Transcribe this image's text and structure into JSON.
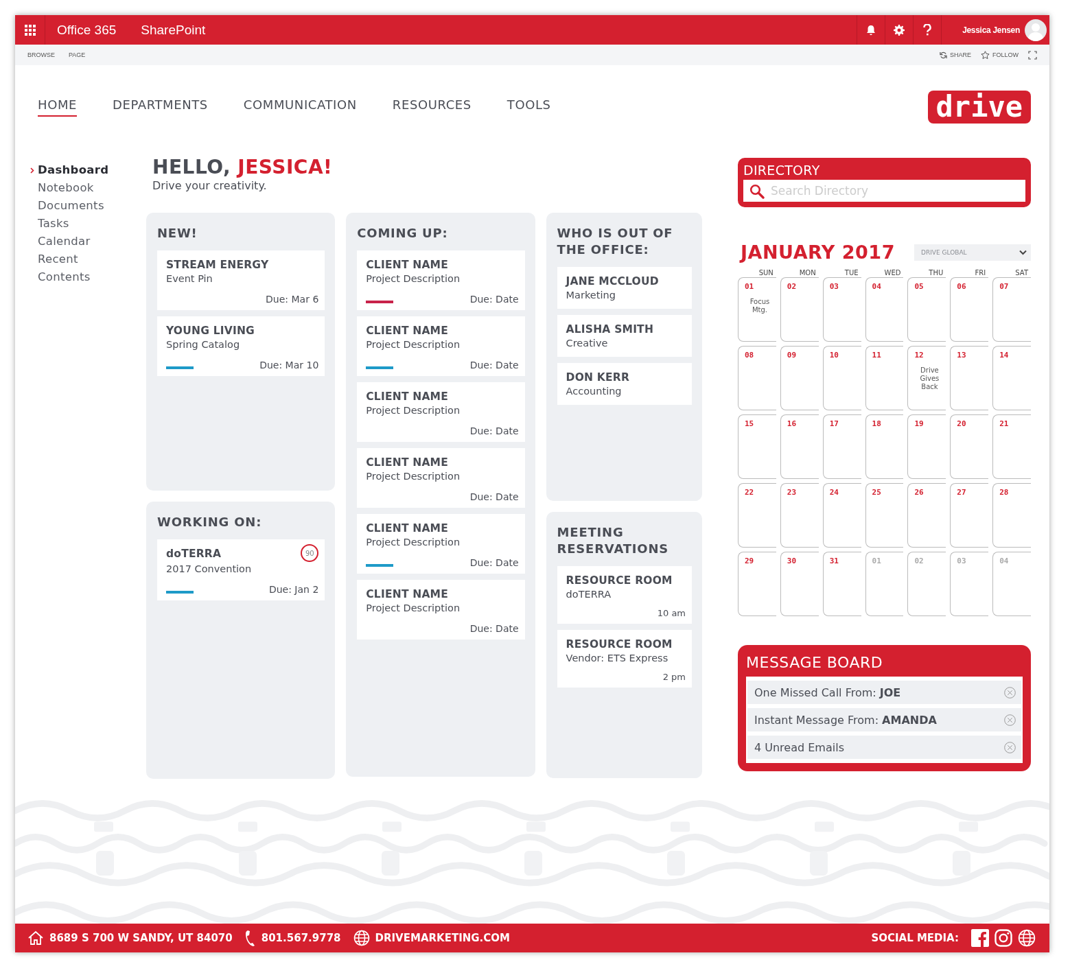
{
  "top_bar": {
    "brand": "Office 365",
    "site": "SharePoint",
    "user": "Jessica Jensen"
  },
  "ribbon_tabs": [
    "BROWSE",
    "PAGE"
  ],
  "ribbon_actions": [
    {
      "kind": "share",
      "label": "SHARE"
    },
    {
      "kind": "follow",
      "label": "FOLLOW"
    }
  ],
  "nav": [
    {
      "label": "HOME",
      "selected": true
    },
    {
      "label": "DEPARTMENTS",
      "selected": false
    },
    {
      "label": "COMMUNICATION",
      "selected": false
    },
    {
      "label": "RESOURCES",
      "selected": false
    },
    {
      "label": "TOOLS",
      "selected": false
    }
  ],
  "logo": "drive",
  "sidebar": [
    {
      "label": "Dashboard",
      "selected": true
    },
    {
      "label": "Notebook",
      "selected": false
    },
    {
      "label": "Documents",
      "selected": false
    },
    {
      "label": "Tasks",
      "selected": false
    },
    {
      "label": "Calendar",
      "selected": false
    },
    {
      "label": "Recent",
      "selected": false
    },
    {
      "label": "Contents",
      "selected": false
    }
  ],
  "greeting": {
    "hello": "HELLO,",
    "name": "JESSICA!",
    "tagline": "Drive your creativity."
  },
  "new": {
    "title": "NEW!",
    "items": [
      {
        "client": "STREAM ENERGY",
        "project": "Event Pin",
        "due": "Due: Mar 6"
      },
      {
        "client": "YOUNG LIVING",
        "project": "Spring Catalog",
        "due": "Due: Mar 10",
        "color": "#1e9ac8"
      }
    ]
  },
  "working_on": {
    "title": "WORKING ON:",
    "items": [
      {
        "client": "doTERRA",
        "project": "2017 Convention",
        "due": "Due: Jan 2",
        "color": "#1e9ac8",
        "badge": "90"
      }
    ]
  },
  "coming_up": {
    "title": "COMING UP:",
    "items": [
      {
        "client": "CLIENT NAME",
        "project": "Project Description",
        "due": "Due: Date",
        "color": "#c8234a"
      },
      {
        "client": "CLIENT NAME",
        "project": "Project Description",
        "due": "Due: Date",
        "color": "#1e9ac8"
      },
      {
        "client": "CLIENT NAME",
        "project": "Project Description",
        "due": "Due: Date"
      },
      {
        "client": "CLIENT NAME",
        "project": "Project Description",
        "due": "Due: Date"
      },
      {
        "client": "CLIENT NAME",
        "project": "Project Description",
        "due": "Due: Date",
        "color": "#1e9ac8"
      },
      {
        "client": "CLIENT NAME",
        "project": "Project Description",
        "due": "Due: Date"
      }
    ]
  },
  "out_of_office": {
    "title": "WHO IS OUT OF THE OFFICE:",
    "people": [
      {
        "name": "JANE MCCLOUD",
        "department": "Marketing"
      },
      {
        "name": "ALISHA SMITH",
        "department": "Creative"
      },
      {
        "name": "DON KERR",
        "department": "Accounting"
      }
    ]
  },
  "meetings": {
    "title": "MEETING RESERVATIONS",
    "items": [
      {
        "room": "RESOURCE ROOM",
        "detail": "doTERRA",
        "time": "10 am"
      },
      {
        "room": "RESOURCE ROOM",
        "detail": "Vendor: ETS Express",
        "time": "2 pm"
      }
    ]
  },
  "directory": {
    "title": "DIRECTORY",
    "placeholder": "Search Directory"
  },
  "calendar": {
    "title": "JANUARY 2017",
    "filter": "DRIVE GLOBAL",
    "weekdays": [
      "SUN",
      "MON",
      "TUE",
      "WED",
      "THU",
      "FRI",
      "SAT"
    ],
    "days": [
      {
        "day": "01",
        "in_month": true,
        "event": "Focus Mtg."
      },
      {
        "day": "02",
        "in_month": true
      },
      {
        "day": "03",
        "in_month": true
      },
      {
        "day": "04",
        "in_month": true
      },
      {
        "day": "05",
        "in_month": true
      },
      {
        "day": "06",
        "in_month": true
      },
      {
        "day": "07",
        "in_month": true
      },
      {
        "day": "08",
        "in_month": true
      },
      {
        "day": "09",
        "in_month": true
      },
      {
        "day": "10",
        "in_month": true
      },
      {
        "day": "11",
        "in_month": true
      },
      {
        "day": "12",
        "in_month": true,
        "event": "Drive Gives Back"
      },
      {
        "day": "13",
        "in_month": true
      },
      {
        "day": "14",
        "in_month": true
      },
      {
        "day": "15",
        "in_month": true
      },
      {
        "day": "16",
        "in_month": true
      },
      {
        "day": "17",
        "in_month": true
      },
      {
        "day": "18",
        "in_month": true
      },
      {
        "day": "19",
        "in_month": true
      },
      {
        "day": "20",
        "in_month": true
      },
      {
        "day": "21",
        "in_month": true
      },
      {
        "day": "22",
        "in_month": true
      },
      {
        "day": "23",
        "in_month": true
      },
      {
        "day": "24",
        "in_month": true
      },
      {
        "day": "25",
        "in_month": true
      },
      {
        "day": "26",
        "in_month": true
      },
      {
        "day": "27",
        "in_month": true
      },
      {
        "day": "28",
        "in_month": true
      },
      {
        "day": "29",
        "in_month": true
      },
      {
        "day": "30",
        "in_month": true
      },
      {
        "day": "31",
        "in_month": true
      },
      {
        "day": "01",
        "in_month": false
      },
      {
        "day": "02",
        "in_month": false
      },
      {
        "day": "03",
        "in_month": false
      },
      {
        "day": "04",
        "in_month": false
      }
    ]
  },
  "message_board": {
    "title": "MESSAGE BOARD",
    "messages": [
      "One Missed Call From: **JOE**",
      "Instant Message From: **AMANDA**",
      "4 Unread Emails"
    ]
  },
  "footer": {
    "address": "8689 S 700 W SANDY, UT 84070",
    "phone": "801.567.9778",
    "website": "DRIVEMARKETING.COM",
    "social_label": "SOCIAL MEDIA:"
  }
}
